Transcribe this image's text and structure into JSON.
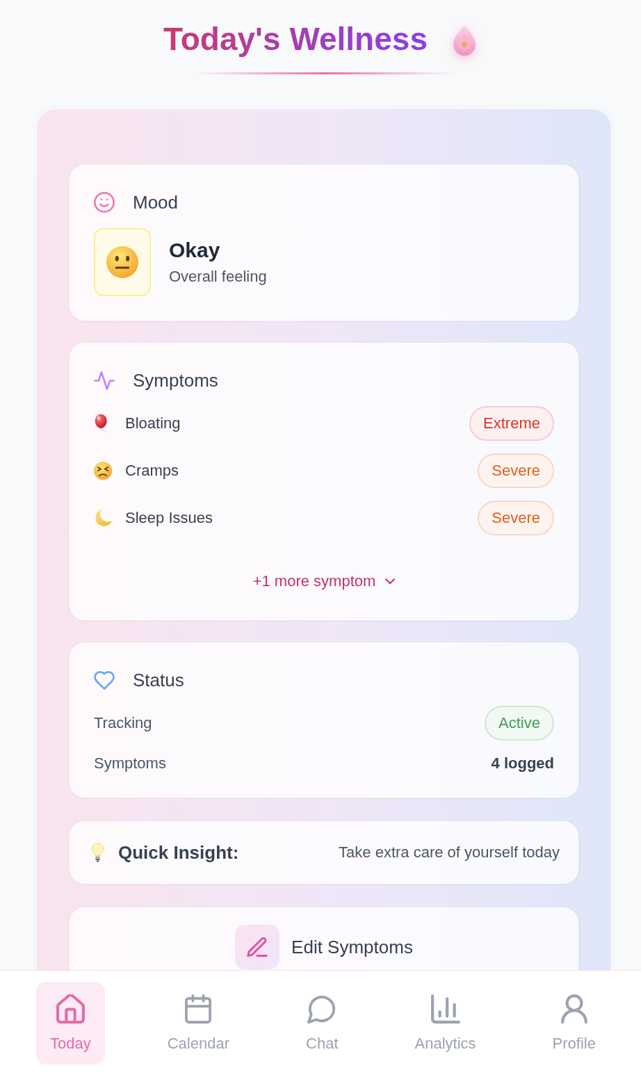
{
  "header": {
    "title": "Today's Wellness"
  },
  "mood": {
    "heading": "Mood",
    "value": "Okay",
    "caption": "Overall feeling"
  },
  "symptoms": {
    "heading": "Symptoms",
    "items": [
      {
        "name": "Bloating",
        "severity": "Extreme",
        "color": "#d9352f"
      },
      {
        "name": "Cramps",
        "severity": "Severe",
        "color": "#e05e1f"
      },
      {
        "name": "Sleep Issues",
        "severity": "Severe",
        "color": "#e05e1f"
      }
    ],
    "more": {
      "label": "+1 more symptom",
      "expanded": false
    }
  },
  "status": {
    "heading": "Status",
    "rows": [
      {
        "kind": "badge",
        "label": "Tracking",
        "value": "Active",
        "color": "#3f9f4f"
      },
      {
        "kind": "text",
        "label": "Symptoms",
        "value": "4 logged"
      }
    ]
  },
  "insight": {
    "label": "Quick Insight:",
    "text": "Take extra care of yourself today"
  },
  "edit_button": {
    "label": "Edit Symptoms"
  },
  "nav": {
    "items": [
      {
        "label": "Today",
        "selected": true
      },
      {
        "label": "Calendar",
        "selected": false
      },
      {
        "label": "Chat",
        "selected": false
      },
      {
        "label": "Analytics",
        "selected": false
      },
      {
        "label": "Profile",
        "selected": false
      }
    ]
  }
}
